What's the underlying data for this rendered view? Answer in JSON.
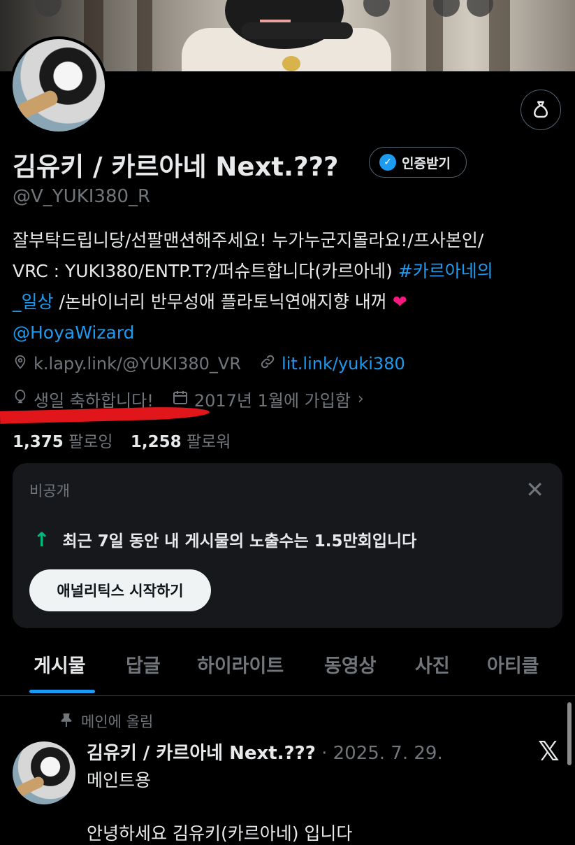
{
  "profile": {
    "name": "김유키 / 카르아네 Next.???",
    "handle": "@V_YUKI380_R",
    "verify_label": "인증받기",
    "bio_lines": [
      "잘부탁드립니당/선팔맨션해주세요! 누가누군지몰라요!/프사본인/",
      "VRC : YUKI380/ENTP.T?/퍼슈트합니다(카르아네)"
    ],
    "bio_hashtag_part1": "#카르아네의",
    "bio_hashtag_part2": "_일상",
    "bio_line3_rest": "/논바이너리 반무성애 플라토닉연애지향 내꺼",
    "bio_mention": "@HoyaWizard",
    "location": "k.lapy.link/@YUKI380_VR",
    "website": "lit.link/yuki380",
    "birthday": "생일 축하합니다!",
    "joined": "2017년 1월에 가입함",
    "following_count": "1,375",
    "following_label": "팔로잉",
    "followers_count": "1,258",
    "followers_label": "팔로워"
  },
  "icons": {
    "location": "location-pin-icon",
    "link": "link-icon",
    "birthday": "balloon-icon",
    "joined": "calendar-icon",
    "chevron": "chevron-right-icon",
    "profile_action": "money-bag-icon",
    "close": "close-icon",
    "up_arrow": "arrow-up-icon",
    "pin": "pin-icon",
    "x_logo": "x-logo-icon",
    "verified": "verified-badge-icon"
  },
  "analytics_card": {
    "private_label": "비공개",
    "stat_text": "최근 7일 동안 내 게시물의 노출수는 1.5만회입니다",
    "button_label": "애널리틱스 시작하기"
  },
  "tabs": [
    {
      "label": "게시물",
      "active": true
    },
    {
      "label": "답글",
      "active": false
    },
    {
      "label": "하이라이트",
      "active": false
    },
    {
      "label": "동영상",
      "active": false
    },
    {
      "label": "사진",
      "active": false
    },
    {
      "label": "아티클",
      "active": false
    }
  ],
  "pinned_post": {
    "pinned_label": "메인에 올림",
    "author": "김유키 / 카르아네 Next.???",
    "date": "2025. 7. 29.",
    "line1": "메인트용",
    "line2": "안녕하세요 김유키(카르아네) 입니다"
  },
  "colors": {
    "background": "#000000",
    "accent": "#1d9bf0",
    "muted": "#71767b",
    "card_bg": "#16181c",
    "success": "#00ba7c",
    "annotation_red": "#e0161b"
  }
}
